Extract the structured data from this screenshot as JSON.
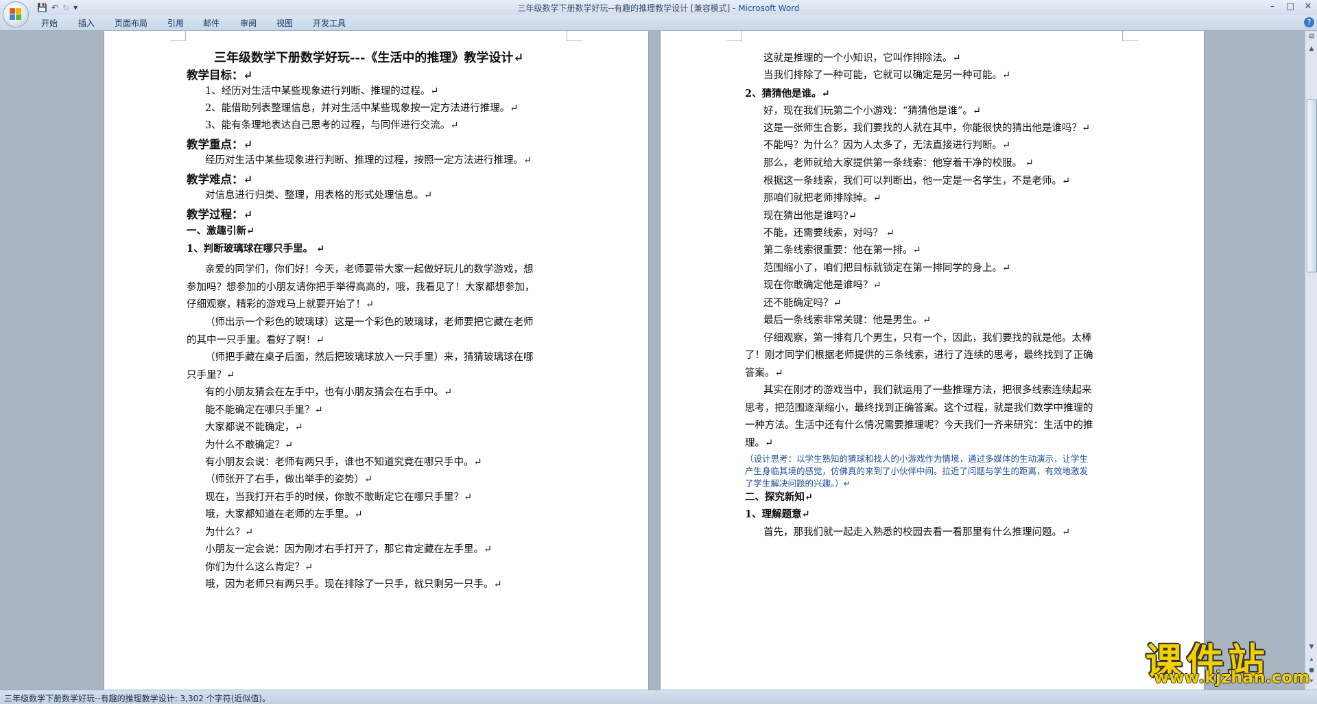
{
  "window": {
    "title_doc": "三年级数学下册数学好玩--有趣的推理教学设计 [兼容模式] -",
    "title_app": "Microsoft Word",
    "controls": [
      "–",
      "□",
      "✕"
    ],
    "help": "?"
  },
  "quick_access": [
    "save-icon",
    "undo-icon",
    "redo-icon",
    "customize-icon"
  ],
  "ribbon": {
    "tabs": [
      "开始",
      "插入",
      "页面布局",
      "引用",
      "邮件",
      "审阅",
      "视图",
      "开发工具"
    ]
  },
  "page1": {
    "lines": [
      "三年级数学下册数学好玩---《生活中的推理》教学设计↵",
      "教学目标：↵",
      "1、经历对生活中某些现象进行判断、推理的过程。↵",
      "2、能借助列表整理信息，并对生活中某些现象按一定方法进行推理。↵",
      "3、能有条理地表达自己思考的过程，与同伴进行交流。↵",
      "教学重点：↵",
      "经历对生活中某些现象进行判断、推理的过程，按照一定方法进行推理。↵",
      "教学难点：↵",
      "对信息进行归类、整理，用表格的形式处理信息。↵",
      "教学过程：↵",
      "一、激趣引新↵",
      "1、判断玻璃球在哪只手里。               ↵",
      "亲爱的同学们，你们好！今天，老师要带大家一起做好玩儿的数学游戏，想",
      "参加吗？想参加的小朋友请你把手举得高高的，哦，我看见了！大家都想参加，",
      "仔细观察，精彩的游戏马上就要开始了！↵",
      "（师出示一个彩色的玻璃球）这是一个彩色的玻璃球，老师要把它藏在老师",
      "的其中一只手里。看好了啊！↵",
      "（师把手藏在桌子后面，然后把玻璃球放入一只手里）来，猜猜玻璃球在哪",
      "只手里？↵",
      "有的小朋友猜会在左手中，也有小朋友猜会在右手中。↵",
      "能不能确定在哪只手里？↵",
      "大家都说不能确定，↵",
      "为什么不敢确定？↵",
      "有小朋友会说：老师有两只手，谁也不知道究竟在哪只手中。↵",
      "（师张开了右手，做出举手的姿势）↵",
      "现在，当我打开右手的时候，你敢不敢断定它在哪只手里？↵",
      "哦，大家都知道在老师的左手里。↵",
      "为什么？↵",
      "小朋友一定会说：因为刚才右手打开了，那它肯定藏在左手里。↵",
      "你们为什么这么肯定？↵",
      "哦，因为老师只有两只手。现在排除了一只手，就只剩另一只手。↵"
    ]
  },
  "page2": {
    "lines": [
      "这就是推理的一个小知识，它叫作排除法。↵",
      "当我们排除了一种可能，它就可以确定是另一种可能。↵",
      "2、猜猜他是谁。↵",
      "好，现在我们玩第二个小游戏：“猜猜他是谁”。↵",
      "这是一张师生合影，我们要找的人就在其中，你能很快的猜出他是谁吗？↵",
      "不能吗？为什么？因为人太多了，无法直接进行判断。↵",
      "那么，老师就给大家提供第一条线索：他穿着干净的校服。 ↵",
      "根据这一条线索，我们可以判断出，他一定是一名学生，不是老师。↵",
      "那咱们就把老师排除掉。↵",
      "现在猜出他是谁吗?↵",
      "不能，还需要线索，对吗？                    ↵",
      "第二条线索很重要：他在第一排。↵",
      "范围缩小了，咱们把目标就锁定在第一排同学的身上。↵",
      "现在你敢确定他是谁吗？↵",
      "还不能确定吗？↵",
      "最后一条线索非常关键：他是男生。↵",
      "仔细观察，第一排有几个男生，只有一个，因此，我们要找的就是他。太棒",
      "了！刚才同学们根据老师提供的三条线索，进行了连续的思考，最终找到了正确",
      "答案。↵",
      "其实在刚才的游戏当中，我们就运用了一些推理方法，把很多线索连续起来",
      "思考，把范围逐渐缩小，最终找到正确答案。这个过程，就是我们数学中推理的",
      "一种方法。生活中还有什么情况需要推理呢？今天我们一齐来研究：生活中的推",
      "理。↵",
      "（设计思考：以学生熟知的猜球和找人的小游戏作为情境，通过多媒体的生动演示，让学生",
      "产生身临其境的感觉，仿佛真的来到了小伙伴中间。拉近了问题与学生的距离，有效地激发",
      "了学生解决问题的兴趣。）↵",
      "二、探究新知↵",
      "1、理解题意↵",
      "首先，那我们就一起走入熟悉的校园去看一看那里有什么推理问题。↵"
    ]
  },
  "status": {
    "text": "三年级数学下册数学好玩--有趣的推理教学设计: 3,302 个字符(近似值)。"
  },
  "watermark": {
    "title": "课件站",
    "url": "www.kjzhan.com"
  },
  "colors": {
    "titlebar": "#dbe5f2",
    "ribbon_tab_text": "#15345e",
    "note_text": "#1f4e99",
    "watermark": "#f2d000"
  }
}
